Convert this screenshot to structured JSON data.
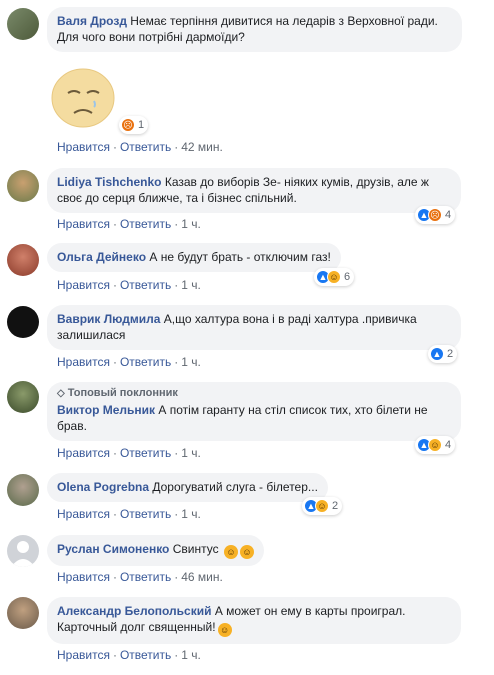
{
  "actions": {
    "like": "Нравится",
    "reply": "Ответить"
  },
  "comments": [
    {
      "author": "Валя Дрозд",
      "text": "Немає терпіння дивитися на ледарів з Верховної ради. Для чого вони потрібні дармоїди?",
      "time": "42 мин.",
      "reactions": "1",
      "sticker": "sad-face-sticker"
    },
    {
      "author": "Lidiya Tishchenko",
      "text": "Казав до виборів Зе- ніяких кумів, друзів, але ж своє до серця ближче, та і бізнес спільний.",
      "time": "1 ч.",
      "reactions": "4"
    },
    {
      "author": "Ольга Дейнеко",
      "text": "А не будут брать - отключим газ!",
      "time": "1 ч.",
      "reactions": "6"
    },
    {
      "author": "Ваврик Людмила",
      "text": "А,що халтура вона і в раді халтура .привичка залишилася",
      "time": "1 ч.",
      "reactions": "2"
    },
    {
      "author": "Виктор Мельник",
      "badge": "Топовый поклонник",
      "text": "А потім гаранту на стіл список тих, хто білети не брав.",
      "time": "1 ч.",
      "reactions": "4"
    },
    {
      "author": "Olena Pogrebna",
      "text": "Дорогуватий слуга - білетер...",
      "time": "1 ч.",
      "reactions": "2"
    },
    {
      "author": "Руслан Симоненко",
      "text": "Свинтус",
      "time": "46 мин."
    },
    {
      "author": "Александр Белопольский",
      "text": "А может он ему в карты проиграл. Карточный долг священный!",
      "time": "1 ч."
    }
  ],
  "colors": {
    "link": "#385898",
    "bubble": "#f2f3f5",
    "meta": "#606770"
  }
}
